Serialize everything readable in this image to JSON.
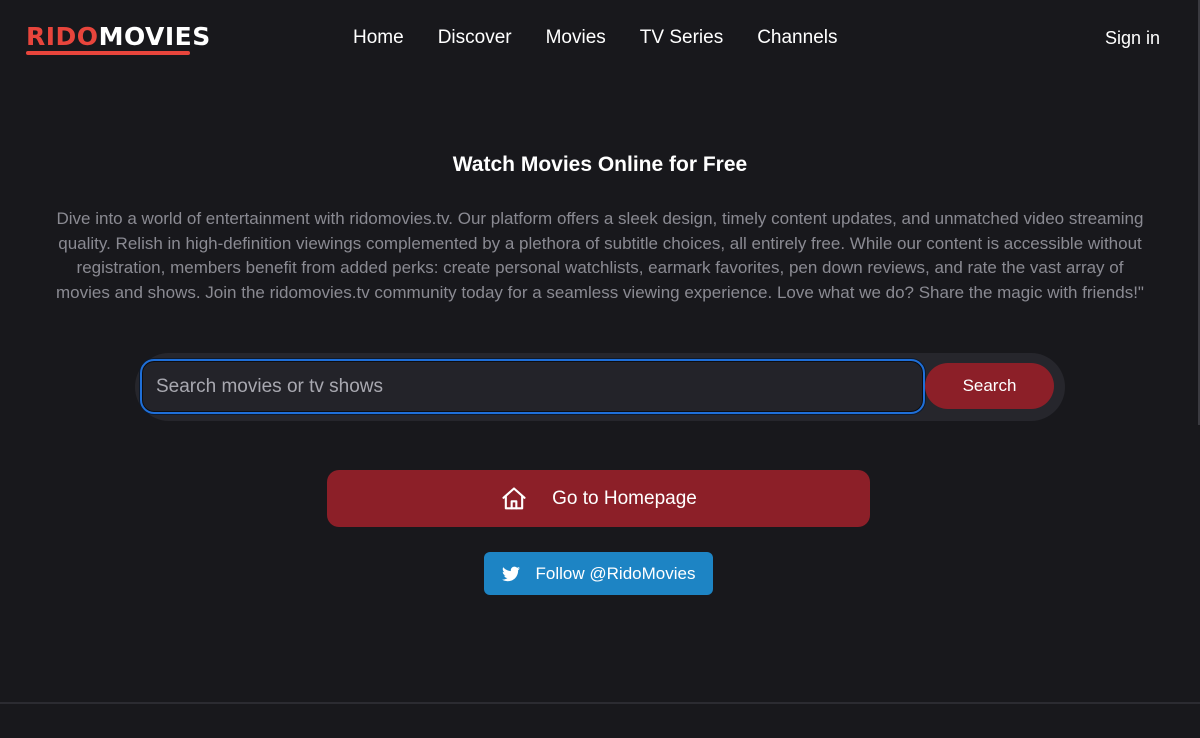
{
  "brand": {
    "part1": "RIDO",
    "part2": "MOVIES",
    "accent": "#e8453c"
  },
  "nav": {
    "items": [
      {
        "label": "Home"
      },
      {
        "label": "Discover"
      },
      {
        "label": "Movies"
      },
      {
        "label": "TV Series"
      },
      {
        "label": "Channels"
      }
    ],
    "signin": "Sign in"
  },
  "hero": {
    "title": "Watch Movies Online for Free",
    "description": "Dive into a world of entertainment with ridomovies.tv. Our platform offers a sleek design, timely content updates, and unmatched video streaming quality. Relish in high-definition viewings complemented by a plethora of subtitle choices, all entirely free. While our content is accessible without registration, members benefit from added perks: create personal watchlists, earmark favorites, pen down reviews, and rate the vast array of movies and shows. Join the ridomovies.tv community today for a seamless viewing experience. Love what we do? Share the magic with friends!\""
  },
  "search": {
    "placeholder": "Search movies or tv shows",
    "value": "",
    "button": "Search"
  },
  "actions": {
    "homepage": {
      "label": "Go to Homepage",
      "icon": "home-icon"
    },
    "twitter": {
      "label": "Follow @RidoMovies",
      "icon": "twitter-icon"
    }
  },
  "colors": {
    "background": "#18181c",
    "primary_button": "#8c1f28",
    "twitter_button": "#1d84c4",
    "focus_ring": "#1f6fd8"
  }
}
